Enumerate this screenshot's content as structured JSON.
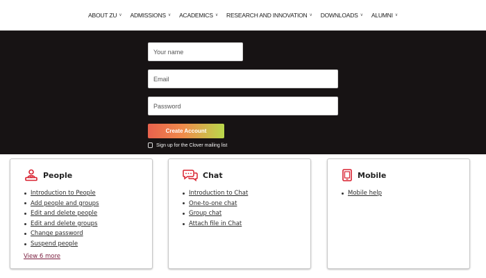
{
  "nav": {
    "items": [
      {
        "label": "ABOUT ZU"
      },
      {
        "label": "ADMISSIONS"
      },
      {
        "label": "ACADEMICS"
      },
      {
        "label": "RESEARCH AND INNOVATION"
      },
      {
        "label": "DOWNLOADS"
      },
      {
        "label": "ALUMNI"
      }
    ]
  },
  "signup": {
    "name_placeholder": "Your name",
    "email_placeholder": "Email",
    "password_placeholder": "Password",
    "create_button": "Create Account",
    "mailing_label": "Sign up for the Clover mailing list"
  },
  "cards": {
    "people": {
      "title": "People",
      "icon": "people-icon",
      "links": [
        "Introduction to People",
        "Add people and groups",
        "Edit and delete people",
        "Edit and delete groups",
        "Change password",
        "Suspend people"
      ],
      "view_more": "View 6 more"
    },
    "chat": {
      "title": "Chat",
      "icon": "chat-icon",
      "links": [
        "Introduction to Chat",
        "One-to-one chat",
        "Group chat",
        "Attach file in Chat"
      ]
    },
    "mobile": {
      "title": "Mobile",
      "icon": "mobile-icon",
      "links": [
        "Mobile help"
      ]
    }
  },
  "colors": {
    "hero_bg": "#171314",
    "accent_red": "#d8202f",
    "view_more": "#7a1d3e"
  }
}
